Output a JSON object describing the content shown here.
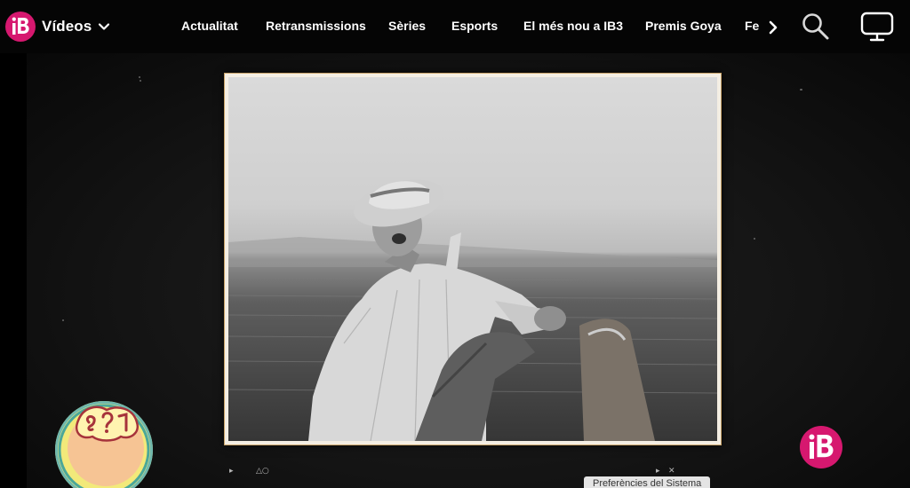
{
  "header": {
    "section_label": "Vídeos",
    "logo_icon": "ib3-logo-icon",
    "dropdown_icon": "chevron-down-icon",
    "nav_items": [
      {
        "label": "Actualitat"
      },
      {
        "label": "Retransmissions"
      },
      {
        "label": "Sèries"
      },
      {
        "label": "Esports"
      },
      {
        "label": "El més nou a IB3"
      },
      {
        "label": "Premis Goya"
      },
      {
        "label": "Fe"
      }
    ],
    "next_icon": "chevron-right-icon",
    "search_icon": "search-icon",
    "cast_icon": "tv-cast-icon"
  },
  "player": {
    "content": "still-photo-frame",
    "program_badge_icon": "program-badge-icon",
    "watermark_icon": "ib3-watermark-icon",
    "leader_marks": [
      "▸",
      "△○",
      "▸",
      "✕"
    ]
  },
  "system_tooltip": {
    "label": "Preferències del Sistema"
  },
  "colors": {
    "brand": "#d6186f",
    "topbar": "#050505",
    "stage": "#141414",
    "text": "#ffffff"
  }
}
